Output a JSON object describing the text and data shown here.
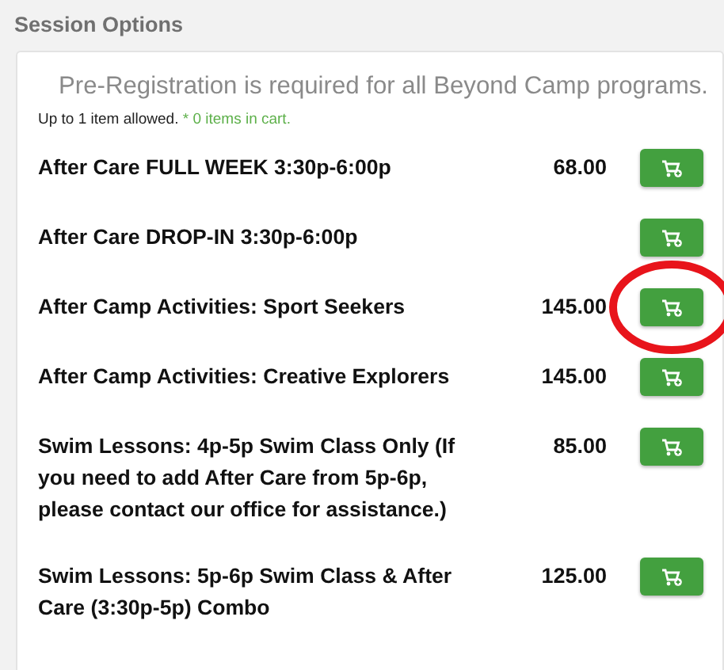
{
  "section_title": "Session Options",
  "notice": "Pre-Registration is required for all Beyond Camp programs.",
  "limit_text": "Up to 1 item allowed.",
  "cart_status": "* 0 items in cart.",
  "sessions": [
    {
      "name": "After Care FULL WEEK 3:30p-6:00p",
      "price": "68.00",
      "highlighted": false
    },
    {
      "name": "After Care DROP-IN 3:30p-6:00p",
      "highlighted": false
    },
    {
      "name": "After Camp Activities: Sport Seekers",
      "price": "145.00",
      "highlighted": true
    },
    {
      "name": "After Camp Activities: Creative Explorers",
      "price": "145.00",
      "highlighted": false
    },
    {
      "name": "Swim Lessons: 4p-5p Swim Class Only (If you need to add After Care from 5p-6p, please contact our office for assistance.)",
      "price": "85.00",
      "highlighted": false
    },
    {
      "name": "Swim Lessons: 5p-6p Swim Class & After Care (3:30p-5p) Combo",
      "price": "125.00",
      "highlighted": false
    }
  ]
}
